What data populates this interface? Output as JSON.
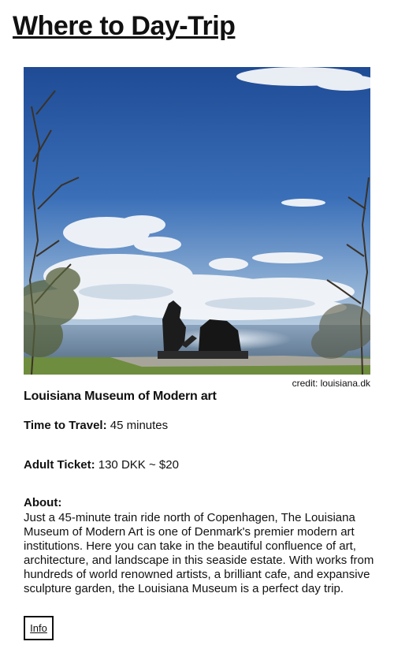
{
  "header": {
    "title": "Where to Day-Trip"
  },
  "photo": {
    "credit": "credit: louisiana.dk"
  },
  "museum": {
    "name": "Louisiana Museum of Modern art",
    "travel_label": "Time to Travel:",
    "travel_value": "45 minutes",
    "ticket_label": "Adult Ticket:",
    "ticket_value": "130 DKK ~ $20",
    "about_label": "About:",
    "about_text": "Just a 45-minute train ride north of Copenhagen, The Louisiana Museum of Modern Art is one of Denmark's premier modern art institutions. Here you can take in the beautiful confluence of art, architecture, and landscape in this seaside estate. With works from hundreds of world renowned artists, a brilliant cafe, and expansive sculpture garden, the Louisiana Museum is a perfect day trip.",
    "info_button": "Info"
  }
}
